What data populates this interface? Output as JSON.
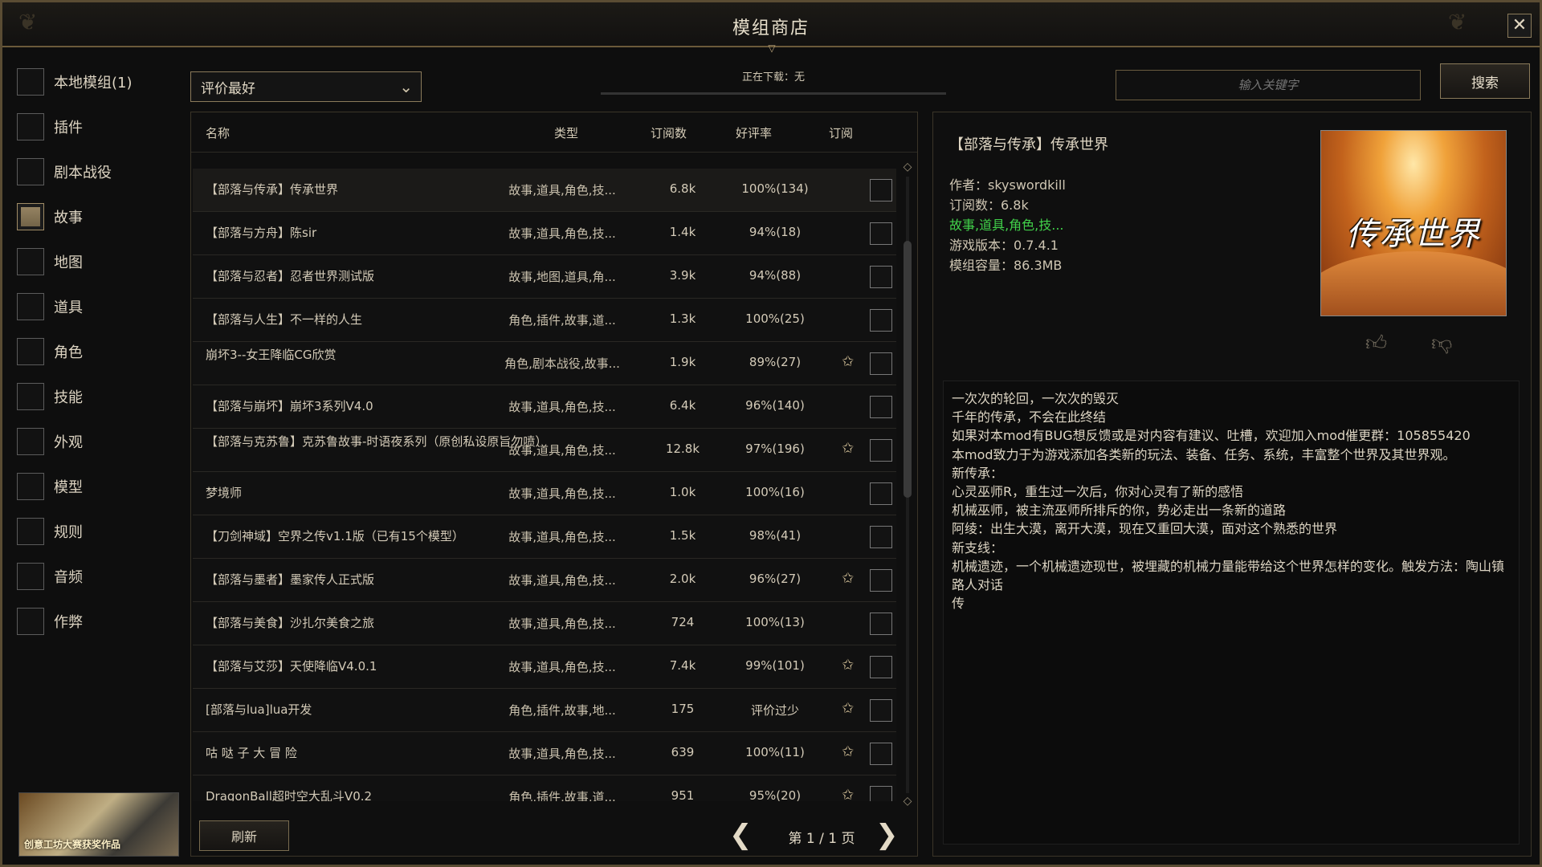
{
  "window": {
    "title": "模组商店",
    "close_icon": "close-icon"
  },
  "sidebar": {
    "categories": [
      {
        "label": "本地模组(1)",
        "checked": false
      },
      {
        "label": "插件",
        "checked": false
      },
      {
        "label": "剧本战役",
        "checked": false
      },
      {
        "label": "故事",
        "checked": true
      },
      {
        "label": "地图",
        "checked": false
      },
      {
        "label": "道具",
        "checked": false
      },
      {
        "label": "角色",
        "checked": false
      },
      {
        "label": "技能",
        "checked": false
      },
      {
        "label": "外观",
        "checked": false
      },
      {
        "label": "模型",
        "checked": false
      },
      {
        "label": "规则",
        "checked": false
      },
      {
        "label": "音频",
        "checked": false
      },
      {
        "label": "作弊",
        "checked": false
      }
    ],
    "banner_text": "创意工坊大赛获奖作品"
  },
  "toolbar": {
    "sort_value": "评价最好",
    "download_status": "正在下载：无",
    "search_placeholder": "输入关键字",
    "search_label": "搜索"
  },
  "list": {
    "headers": {
      "name": "名称",
      "types": "类型",
      "subs": "订阅数",
      "rate": "好评率",
      "subscribe": "订阅"
    },
    "rows": [
      {
        "name": "【部落与传承】传承世界",
        "types": "故事,道具,角色,技...",
        "subs": "6.8k",
        "rate": "100%(134)",
        "star": false,
        "selected": true
      },
      {
        "name": "【部落与方舟】陈sir",
        "types": "故事,道具,角色,技...",
        "subs": "1.4k",
        "rate": "94%(18)",
        "star": false
      },
      {
        "name": "【部落与忍者】忍者世界测试版",
        "types": "故事,地图,道具,角...",
        "subs": "3.9k",
        "rate": "94%(88)",
        "star": false
      },
      {
        "name": "【部落与人生】不一样的人生",
        "types": "角色,插件,故事,道...",
        "subs": "1.3k",
        "rate": "100%(25)",
        "star": false
      },
      {
        "name": "崩坏3--女王降临CG欣赏",
        "types": "角色,剧本战役,故事...",
        "subs": "1.9k",
        "rate": "89%(27)",
        "star": true,
        "top_align": true
      },
      {
        "name": "【部落与崩坏】崩坏3系列V4.0",
        "types": "故事,道具,角色,技...",
        "subs": "6.4k",
        "rate": "96%(140)",
        "star": false
      },
      {
        "name": "【部落与克苏鲁】克苏鲁故事-时语夜系列（原创私设原旨勿喷）",
        "types": "故事,道具,角色,技...",
        "subs": "12.8k",
        "rate": "97%(196)",
        "star": true,
        "two_line": true
      },
      {
        "name": "梦境师",
        "types": "故事,道具,角色,技...",
        "subs": "1.0k",
        "rate": "100%(16)",
        "star": false
      },
      {
        "name": "【刀剑神域】空界之传v1.1版（已有15个模型）",
        "types": "故事,道具,角色,技...",
        "subs": "1.5k",
        "rate": "98%(41)",
        "star": false
      },
      {
        "name": "【部落与墨者】墨家传人正式版",
        "types": "故事,道具,角色,技...",
        "subs": "2.0k",
        "rate": "96%(27)",
        "star": true
      },
      {
        "name": "【部落与美食】沙扎尔美食之旅",
        "types": "故事,道具,角色,技...",
        "subs": "724",
        "rate": "100%(13)",
        "star": false
      },
      {
        "name": "【部落与艾莎】天使降临V4.0.1",
        "types": "故事,道具,角色,技...",
        "subs": "7.4k",
        "rate": "99%(101)",
        "star": true
      },
      {
        "name": "[部落与lua]lua开发",
        "types": "角色,插件,故事,地...",
        "subs": "175",
        "rate": "评价过少",
        "star": true
      },
      {
        "name": "咕 哒 子 大 冒 险",
        "types": "故事,道具,角色,技...",
        "subs": "639",
        "rate": "100%(11)",
        "star": true
      },
      {
        "name": "DragonBall超时空大乱斗V0.2",
        "types": "角色,插件,故事,道...",
        "subs": "951",
        "rate": "95%(20)",
        "star": true
      }
    ],
    "refresh_label": "刷新",
    "page_label": "第 1 / 1 页"
  },
  "detail": {
    "title": "【部落与传承】传承世界",
    "author": "作者：skyswordkill",
    "subs": "订阅数：6.8k",
    "tags": "故事,道具,角色,技...",
    "version": "游戏版本：0.7.4.1",
    "size": "模组容量：86.3MB",
    "cover_text": "传承世界",
    "description": "一次次的轮回，一次次的毁灭\n千年的传承，不会在此终结\n如果对本mod有BUG想反馈或是对内容有建议、吐槽，欢迎加入mod催更群：105855420\n本mod致力于为游戏添加各类新的玩法、装备、任务、系统，丰富整个世界及其世界观。\n新传承：\n心灵巫师R，重生过一次后，你对心灵有了新的感悟\n机械巫师，被主流巫师所排斥的你，势必走出一条新的道路\n阿绫：出生大漠，离开大漠，现在又重回大漠，面对这个熟悉的世界\n新支线：\n机械遗迹，一个机械遗迹现世，被埋藏的机械力量能带给这个世界怎样的变化。触发方法：陶山镇路人对话\n传"
  },
  "colors": {
    "accent": "#8a7a5a",
    "tag_green": "#41d14a",
    "background": "#0e0e0e"
  }
}
